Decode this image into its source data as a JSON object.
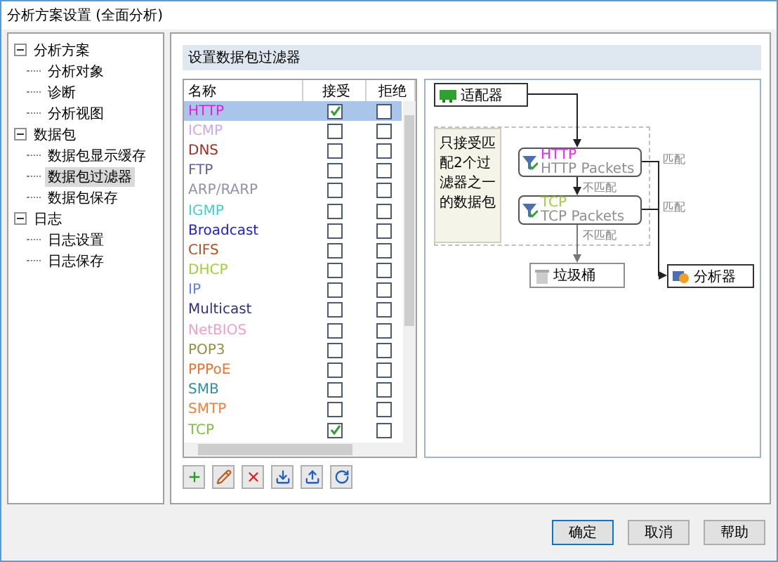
{
  "window": {
    "title": "分析方案设置 (全面分析)"
  },
  "tree": [
    {
      "label": "分析方案",
      "expanded": true,
      "selected": false,
      "children": [
        {
          "label": "分析对象",
          "selected": false
        },
        {
          "label": "诊断",
          "selected": false
        },
        {
          "label": "分析视图",
          "selected": false
        }
      ]
    },
    {
      "label": "数据包",
      "expanded": true,
      "selected": false,
      "children": [
        {
          "label": "数据包显示缓存",
          "selected": false
        },
        {
          "label": "数据包过滤器",
          "selected": true
        },
        {
          "label": "数据包保存",
          "selected": false
        }
      ]
    },
    {
      "label": "日志",
      "expanded": true,
      "selected": false,
      "children": [
        {
          "label": "日志设置",
          "selected": false
        },
        {
          "label": "日志保存",
          "selected": false
        }
      ]
    }
  ],
  "section_title": "设置数据包过滤器",
  "table": {
    "columns": [
      "名称",
      "接受",
      "拒绝"
    ],
    "rows": [
      {
        "name": "HTTP",
        "color": "#e020e0",
        "accept": true,
        "reject": false,
        "selected": true
      },
      {
        "name": "ICMP",
        "color": "#d0a8f0",
        "accept": false,
        "reject": false,
        "selected": false
      },
      {
        "name": "DNS",
        "color": "#a03020",
        "accept": false,
        "reject": false,
        "selected": false
      },
      {
        "name": "FTP",
        "color": "#6060a0",
        "accept": false,
        "reject": false,
        "selected": false
      },
      {
        "name": "ARP/RARP",
        "color": "#9090b0",
        "accept": false,
        "reject": false,
        "selected": false
      },
      {
        "name": "IGMP",
        "color": "#40d0d0",
        "accept": false,
        "reject": false,
        "selected": false
      },
      {
        "name": "Broadcast",
        "color": "#2020e0",
        "accept": false,
        "reject": false,
        "selected": false
      },
      {
        "name": "CIFS",
        "color": "#b05020",
        "accept": false,
        "reject": false,
        "selected": false
      },
      {
        "name": "DHCP",
        "color": "#a0d040",
        "accept": false,
        "reject": false,
        "selected": false
      },
      {
        "name": "IP",
        "color": "#6080f0",
        "accept": false,
        "reject": false,
        "selected": false
      },
      {
        "name": "Multicast",
        "color": "#303080",
        "accept": false,
        "reject": false,
        "selected": false
      },
      {
        "name": "NetBIOS",
        "color": "#f0a0d0",
        "accept": false,
        "reject": false,
        "selected": false
      },
      {
        "name": "POP3",
        "color": "#909040",
        "accept": false,
        "reject": false,
        "selected": false
      },
      {
        "name": "PPPoE",
        "color": "#f07030",
        "accept": false,
        "reject": false,
        "selected": false
      },
      {
        "name": "SMB",
        "color": "#3090a0",
        "accept": false,
        "reject": false,
        "selected": false
      },
      {
        "name": "SMTP",
        "color": "#f08040",
        "accept": false,
        "reject": false,
        "selected": false
      },
      {
        "name": "TCP",
        "color": "#80c040",
        "accept": true,
        "reject": false,
        "selected": false
      }
    ]
  },
  "toolbar": [
    {
      "kind": "add"
    },
    {
      "kind": "edit"
    },
    {
      "kind": "delete"
    },
    {
      "kind": "import"
    },
    {
      "kind": "export"
    },
    {
      "kind": "refresh"
    }
  ],
  "diagram": {
    "adapter": "适配器",
    "note": "只接受匹配2个过滤器之一的数据包",
    "filters": [
      {
        "title": "HTTP",
        "subtitle": "HTTP Packets",
        "color": "#ff20ff",
        "match": "匹配",
        "nomatch": "不匹配"
      },
      {
        "title": "TCP",
        "subtitle": "TCP Packets",
        "color": "#a0d040",
        "match": "匹配",
        "nomatch": "不匹配"
      }
    ],
    "trash": "垃圾桶",
    "analyzer": "分析器"
  },
  "buttons": [
    "确定",
    "取消",
    "帮助"
  ]
}
